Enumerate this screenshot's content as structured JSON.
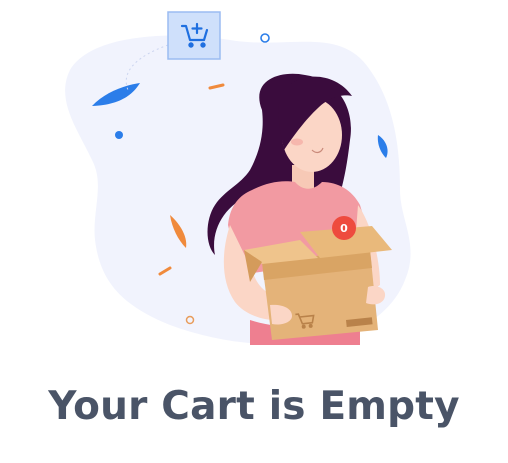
{
  "empty_cart": {
    "title": "Your Cart is Empty",
    "cart_count": "0",
    "illustration_icon": "cart-plus-icon"
  },
  "colors": {
    "title": "#4a5467",
    "accent_blue": "#2b7de9",
    "badge_red": "#ee4b3e",
    "blob_bg": "#f1f3fd",
    "shirt_pink": "#f29aa2",
    "hair": "#3a0c3d",
    "box": "#e4b379"
  }
}
